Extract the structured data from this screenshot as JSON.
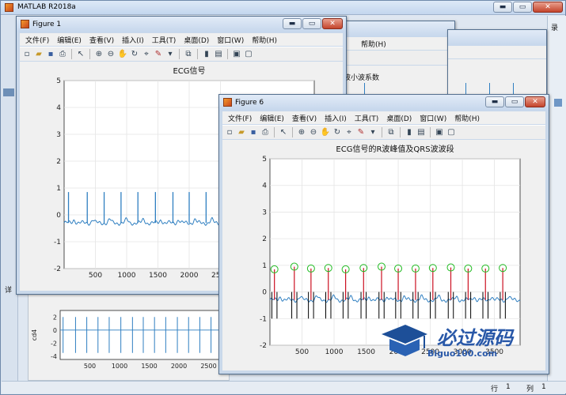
{
  "matlab": {
    "title": "MATLAB R2018a",
    "status": {
      "row_label": "行",
      "row_value": "1",
      "col_label": "列",
      "col_value": "1"
    },
    "side_fragments": {
      "search": "录",
      "left_letter": "详"
    }
  },
  "menu": [
    "文件(F)",
    "编辑(E)",
    "查看(V)",
    "插入(I)",
    "工具(T)",
    "桌面(D)",
    "窗口(W)",
    "帮助(H)"
  ],
  "figure1": {
    "title": "Figure 1",
    "chart_title": "ECG信号"
  },
  "figure_back": {
    "chart_title_fragment": "波小波系数"
  },
  "figure6": {
    "title": "Figure 6",
    "chart_title": "ECG信号的R波峰值及QRS波波段"
  },
  "bottom_axes": {
    "ylabel": "cd4"
  },
  "watermark": {
    "text": "必过源码",
    "url": "Biguo100.com"
  },
  "colors": {
    "signal": "#2f7fc1",
    "peak_marker": "#22bb22",
    "r_line": "#cc1122",
    "qrs_line": "#000000"
  },
  "chart_data": [
    {
      "type": "line",
      "title": "ECG信号",
      "xticks": [
        500,
        1000,
        1500,
        2000,
        2500
      ],
      "yticks": [
        5,
        4,
        3,
        2,
        1,
        0,
        -1,
        -2
      ],
      "xlim": [
        0,
        4000
      ],
      "ylim": [
        -2,
        5
      ],
      "grid": true,
      "baseline": -0.3,
      "r_peak_x": [
        70,
        370,
        640,
        910,
        1180,
        1460,
        1740,
        2000,
        2270,
        2540,
        2820,
        3090,
        3360,
        3630
      ],
      "r_peak_height": [
        0.85,
        0.85,
        0.85,
        0.85,
        0.85,
        0.85,
        0.85,
        0.85,
        0.85,
        0.85,
        0.85,
        0.85,
        0.85,
        0.85
      ]
    },
    {
      "type": "line",
      "title": "ECG信号的R波峰值及QRS波波段",
      "xticks": [
        500,
        1000,
        1500,
        2000,
        2500,
        3000,
        3500
      ],
      "yticks": [
        5,
        4,
        3,
        2,
        1,
        0,
        -1,
        -2
      ],
      "xlim": [
        0,
        3900
      ],
      "ylim": [
        -2,
        5
      ],
      "grid": true,
      "baseline": -0.3,
      "r_peak_x": [
        70,
        380,
        640,
        910,
        1180,
        1460,
        1740,
        2000,
        2270,
        2540,
        2820,
        3090,
        3360,
        3630
      ],
      "r_peak_y": [
        0.85,
        0.95,
        0.88,
        0.9,
        0.85,
        0.9,
        0.95,
        0.88,
        0.88,
        0.9,
        0.92,
        0.88,
        0.88,
        0.9
      ],
      "series": [
        {
          "name": "",
          "kind": "ecg"
        },
        {
          "name": "",
          "kind": "r-peaks"
        },
        {
          "name": "",
          "kind": "qrs-bounds"
        }
      ]
    },
    {
      "type": "line",
      "ylabel": "cd4",
      "xticks": [
        500,
        1000,
        1500,
        2000,
        2500
      ],
      "yticks": [
        2,
        0,
        -2,
        -4
      ],
      "xlim": [
        0,
        2800
      ],
      "ylim": [
        -4.5,
        3
      ]
    }
  ]
}
